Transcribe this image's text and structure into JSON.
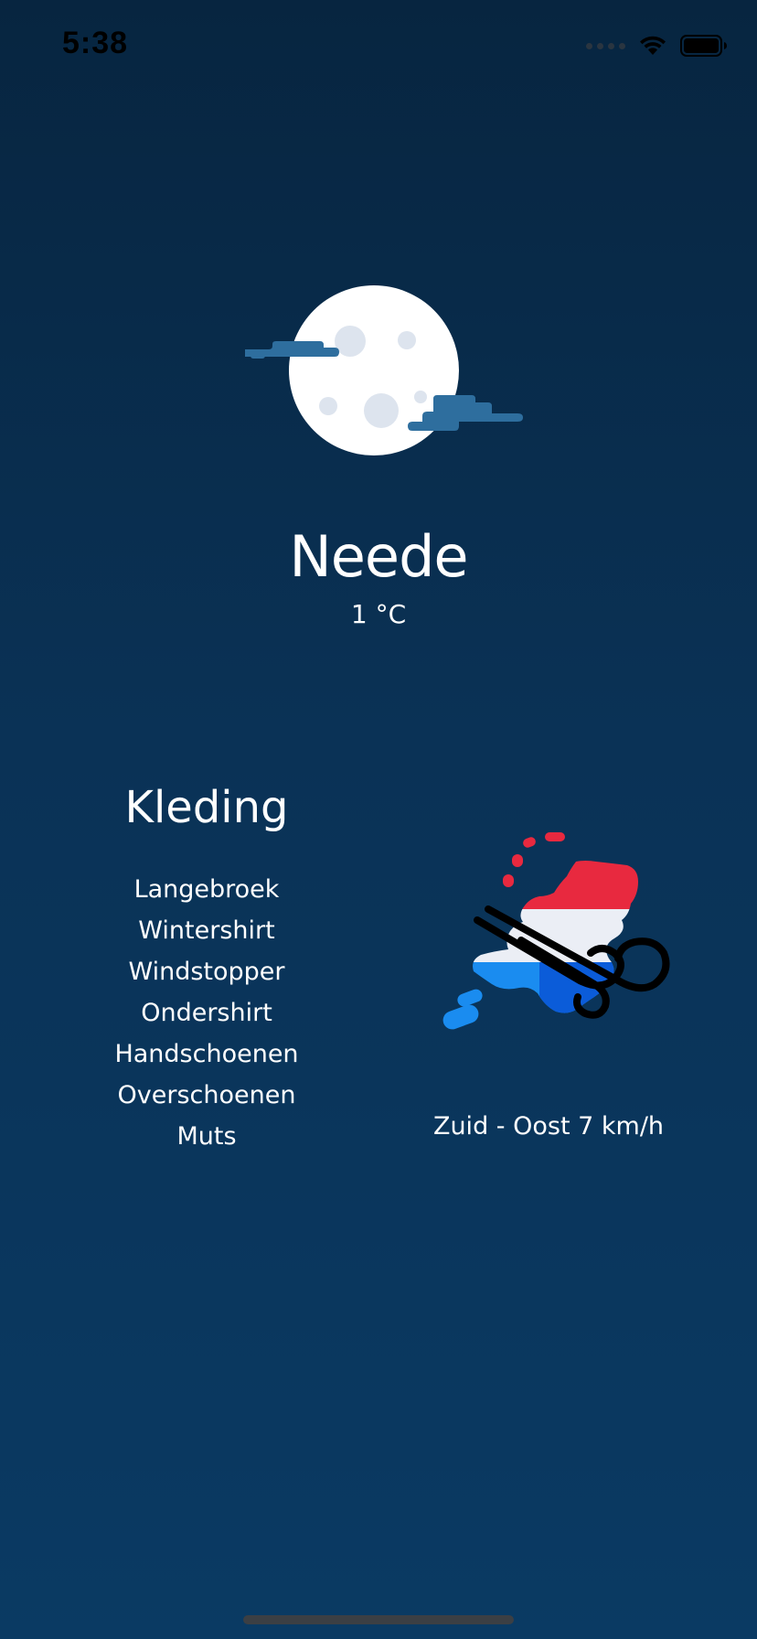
{
  "status_bar": {
    "time": "5:38",
    "icons": [
      "signal-dots-icon",
      "wifi-icon",
      "battery-icon"
    ]
  },
  "weather": {
    "icon": "moon-with-clouds-icon",
    "city": "Neede",
    "temperature": "1 °C"
  },
  "clothing": {
    "title": "Kleding",
    "items": [
      "Langebroek",
      "Wintershirt",
      "Windstopper",
      "Ondershirt",
      "Handschoenen",
      "Overschoenen",
      "Muts"
    ]
  },
  "wind": {
    "icon": "wind-netherlands-icon",
    "label": "Zuid - Oost 7 km/h"
  },
  "colors": {
    "background_top": "#072540",
    "background_bottom": "#0a3a63",
    "cloud": "#2e6e9e",
    "moon": "#ffffff",
    "crater": "#dde4ee",
    "flag_red": "#e8293f",
    "flag_white": "#ebeef5",
    "flag_blue": "#1a8cf0"
  }
}
